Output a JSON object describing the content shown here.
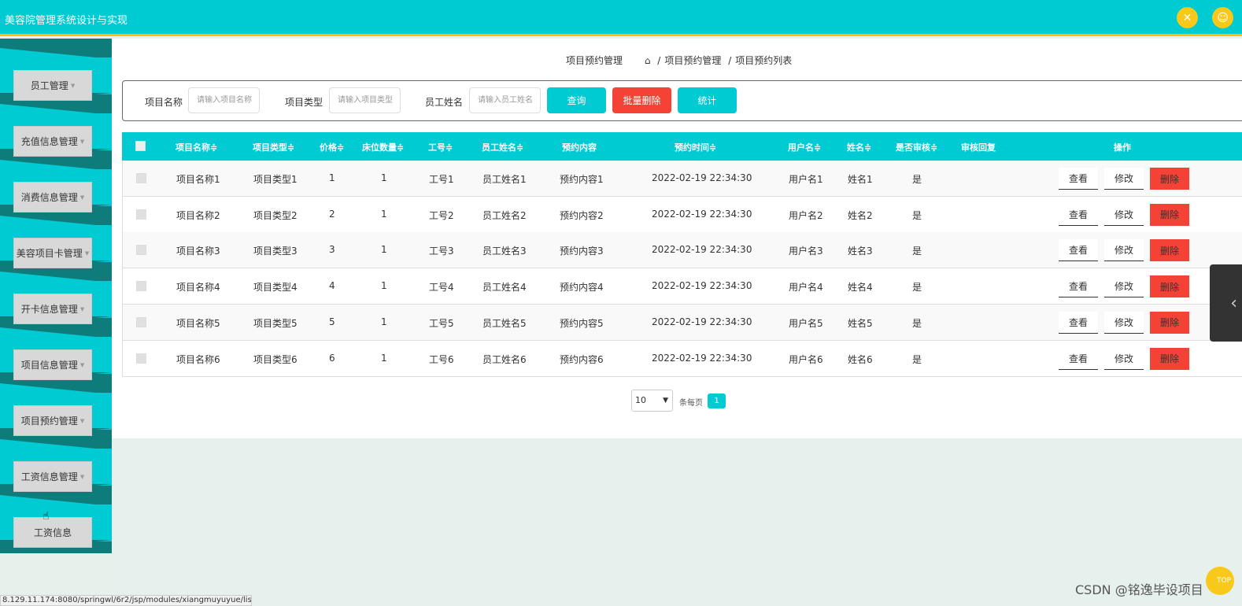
{
  "app": {
    "title": "美容院管理系统设计与实现"
  },
  "sidebar": {
    "items": [
      {
        "label": "员工管理"
      },
      {
        "label": "充值信息管理"
      },
      {
        "label": "消费信息管理"
      },
      {
        "label": "美容项目卡管理"
      },
      {
        "label": "开卡信息管理"
      },
      {
        "label": "项目信息管理"
      },
      {
        "label": "项目预约管理"
      },
      {
        "label": "工资信息管理"
      },
      {
        "label": "工资信息"
      }
    ]
  },
  "breadcrumb": {
    "current": "项目预约管理",
    "path_1": "项目预约管理",
    "path_2": "项目预约列表"
  },
  "search": {
    "name_label": "项目名称",
    "name_placeholder": "请输入项目名称",
    "type_label": "项目类型",
    "type_placeholder": "请输入项目类型",
    "staff_label": "员工姓名",
    "staff_placeholder": "请输入员工姓名",
    "query_label": "查询",
    "batch_delete_label": "批量删除",
    "stats_label": "统计"
  },
  "table": {
    "headers": [
      "项目名称≑",
      "项目类型≑",
      "价格≑",
      "床位数量≑",
      "工号≑",
      "员工姓名≑",
      "预约内容",
      "预约时间≑",
      "用户名≑",
      "姓名≑",
      "是否审核≑",
      "审核回复",
      "操作"
    ],
    "rows": [
      [
        "项目名称1",
        "项目类型1",
        "1",
        "1",
        "工号1",
        "员工姓名1",
        "预约内容1",
        "2022-02-19 22:34:30",
        "用户名1",
        "姓名1",
        "是",
        ""
      ],
      [
        "项目名称2",
        "项目类型2",
        "2",
        "1",
        "工号2",
        "员工姓名2",
        "预约内容2",
        "2022-02-19 22:34:30",
        "用户名2",
        "姓名2",
        "是",
        ""
      ],
      [
        "项目名称3",
        "项目类型3",
        "3",
        "1",
        "工号3",
        "员工姓名3",
        "预约内容3",
        "2022-02-19 22:34:30",
        "用户名3",
        "姓名3",
        "是",
        ""
      ],
      [
        "项目名称4",
        "项目类型4",
        "4",
        "1",
        "工号4",
        "员工姓名4",
        "预约内容4",
        "2022-02-19 22:34:30",
        "用户名4",
        "姓名4",
        "是",
        ""
      ],
      [
        "项目名称5",
        "项目类型5",
        "5",
        "1",
        "工号5",
        "员工姓名5",
        "预约内容5",
        "2022-02-19 22:34:30",
        "用户名5",
        "姓名5",
        "是",
        ""
      ],
      [
        "项目名称6",
        "项目类型6",
        "6",
        "1",
        "工号6",
        "员工姓名6",
        "预约内容6",
        "2022-02-19 22:34:30",
        "用户名6",
        "姓名6",
        "是",
        ""
      ]
    ],
    "actions": {
      "view": "查看",
      "edit": "修改",
      "delete": "删除"
    }
  },
  "pagination": {
    "page_size": "10",
    "per_page_label": "条每页",
    "current_page": "1"
  },
  "status_bar": {
    "url": "8.129.11.174:8080/springwl/6r2/jsp/modules/xiangmuyuyue/list.jsp#"
  },
  "watermark": "CSDN @铭逸毕设项目",
  "colors": {
    "primary": "#00cbd3",
    "accent": "#ffc107",
    "danger": "#f44336",
    "sidebar_dark": "#0f7c7c"
  }
}
